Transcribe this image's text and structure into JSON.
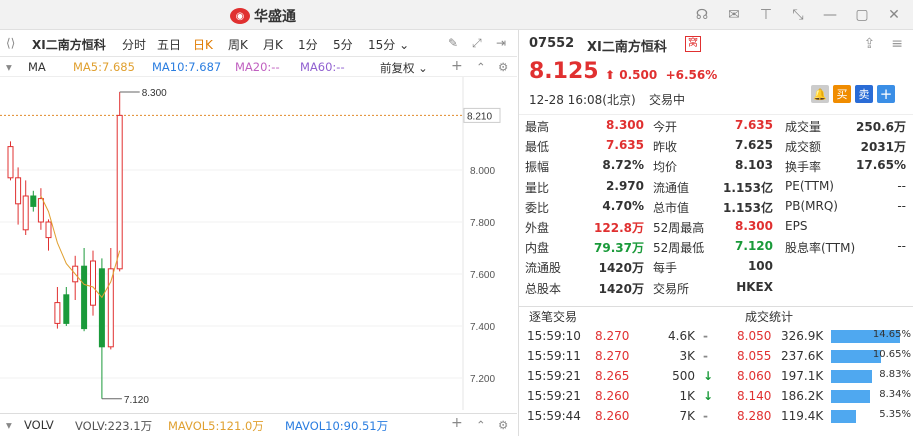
{
  "brand": {
    "name": "华盛通"
  },
  "toolbar": {
    "title": "XI二南方恒科",
    "periods": [
      "分时",
      "五日",
      "日K",
      "周K",
      "月K",
      "1分",
      "5分",
      "15分 ⌄"
    ],
    "active": "日K"
  },
  "indicators": {
    "ma": "MA",
    "ma5": "MA5:7.685",
    "ma10": "MA10:7.687",
    "ma20": "MA20:--",
    "ma60": "MA60:--",
    "adjust": "前复权 ⌄",
    "plus": "+",
    "gear": "⚙"
  },
  "chart_data": {
    "type": "candlestick",
    "y_ticks": [
      "8.000",
      "7.800",
      "7.600",
      "7.400",
      "7.200"
    ],
    "high_label": "8.300",
    "low_label": "7.120",
    "current_label": "8.210",
    "candles": [
      {
        "o": 7.97,
        "c": 8.09,
        "h": 8.11,
        "l": 7.96
      },
      {
        "o": 7.87,
        "c": 7.97,
        "h": 8.01,
        "l": 7.79
      },
      {
        "o": 7.77,
        "c": 7.9,
        "h": 7.96,
        "l": 7.75
      },
      {
        "o": 7.9,
        "c": 7.86,
        "h": 7.92,
        "l": 7.84
      },
      {
        "o": 7.8,
        "c": 7.89,
        "h": 7.93,
        "l": 7.77
      },
      {
        "o": 7.74,
        "c": 7.8,
        "h": 7.81,
        "l": 7.69
      },
      {
        "o": 7.41,
        "c": 7.49,
        "h": 7.55,
        "l": 7.39
      },
      {
        "o": 7.52,
        "c": 7.41,
        "h": 7.55,
        "l": 7.4
      },
      {
        "o": 7.57,
        "c": 7.63,
        "h": 7.67,
        "l": 7.5
      },
      {
        "o": 7.63,
        "c": 7.39,
        "h": 7.7,
        "l": 7.38
      },
      {
        "o": 7.48,
        "c": 7.65,
        "h": 7.69,
        "l": 7.44
      },
      {
        "o": 7.62,
        "c": 7.32,
        "h": 7.66,
        "l": 7.12
      },
      {
        "o": 7.32,
        "c": 7.62,
        "h": 7.7,
        "l": 7.31
      },
      {
        "o": 7.62,
        "c": 8.21,
        "h": 8.3,
        "l": 7.61
      }
    ],
    "ma_line": [
      null,
      null,
      null,
      null,
      7.9,
      7.84,
      7.72,
      7.64,
      7.6,
      7.56,
      7.55,
      7.51,
      7.57,
      7.69
    ]
  },
  "volume": {
    "volv": "VOLV",
    "volv_val": "VOLV:223.1万",
    "mavol5": "MAVOL5:121.0万",
    "mavol10": "MAVOL10:90.51万"
  },
  "stock": {
    "code": "07552",
    "name": "XI二南方恒科",
    "badge": "窝",
    "price": "8.125",
    "change": "0.500",
    "change_pct": "+6.56%",
    "time": "12-28  16:08(北京)",
    "status": "交易中",
    "buy": "买",
    "sell": "卖",
    "add": "+"
  },
  "stats": [
    [
      {
        "l": "最高",
        "v": "8.300",
        "c": "r"
      },
      {
        "l": "今开",
        "v": "7.635",
        "c": "r"
      },
      {
        "l": "成交量",
        "v": "250.6万",
        "c": "b"
      }
    ],
    [
      {
        "l": "最低",
        "v": "7.635",
        "c": "r"
      },
      {
        "l": "昨收",
        "v": "7.625",
        "c": "b"
      },
      {
        "l": "成交额",
        "v": "2031万",
        "c": "b"
      }
    ],
    [
      {
        "l": "振幅",
        "v": "8.72%",
        "c": "b"
      },
      {
        "l": "均价",
        "v": "8.103",
        "c": "b"
      },
      {
        "l": "换手率",
        "v": "17.65%",
        "c": "b"
      }
    ],
    [
      {
        "l": "量比",
        "v": "2.970",
        "c": "b"
      },
      {
        "l": "流通值",
        "v": "1.153亿",
        "c": "b"
      },
      {
        "l": "PE(TTM)",
        "v": "--",
        "c": "l"
      }
    ],
    [
      {
        "l": "委比",
        "v": "4.70%",
        "c": "b"
      },
      {
        "l": "总市值",
        "v": "1.153亿",
        "c": "b"
      },
      {
        "l": "PB(MRQ)",
        "v": "--",
        "c": "l"
      }
    ],
    [
      {
        "l": "外盘",
        "v": "122.8万",
        "c": "r"
      },
      {
        "l": "52周最高",
        "v": "8.300",
        "c": "r"
      },
      {
        "l": "EPS",
        "v": "",
        "c": "l"
      }
    ],
    [
      {
        "l": "内盘",
        "v": "79.37万",
        "c": "g"
      },
      {
        "l": "52周最低",
        "v": "7.120",
        "c": "g"
      },
      {
        "l": "股息率(TTM)",
        "v": "--",
        "c": "l"
      }
    ],
    [
      {
        "l": "流通股",
        "v": "1420万",
        "c": "b"
      },
      {
        "l": "每手",
        "v": "100",
        "c": "b"
      },
      {
        "l": "",
        "v": "",
        "c": "l"
      }
    ],
    [
      {
        "l": "总股本",
        "v": "1420万",
        "c": "b"
      },
      {
        "l": "交易所",
        "v": "HKEX",
        "c": "b"
      },
      {
        "l": "",
        "v": "",
        "c": "l"
      }
    ]
  ],
  "trades_title": "逐笔交易",
  "stats_title": "成交统计",
  "trades": [
    {
      "t": "15:59:10",
      "p": "8.270",
      "q": "4.6K",
      "d": "-",
      "sp": "8.050",
      "sv": "326.9K",
      "pct": "14.65%",
      "f": 0.98
    },
    {
      "t": "15:59:11",
      "p": "8.270",
      "q": "3K",
      "d": "-",
      "sp": "8.055",
      "sv": "237.6K",
      "pct": "10.65%",
      "f": 0.71
    },
    {
      "t": "15:59:21",
      "p": "8.265",
      "q": "500",
      "d": "↓",
      "sp": "8.060",
      "sv": "197.1K",
      "pct": "8.83%",
      "f": 0.59
    },
    {
      "t": "15:59:21",
      "p": "8.260",
      "q": "1K",
      "d": "↓",
      "sp": "8.140",
      "sv": "186.2K",
      "pct": "8.34%",
      "f": 0.56
    },
    {
      "t": "15:59:44",
      "p": "8.260",
      "q": "7K",
      "d": "-",
      "sp": "8.280",
      "sv": "119.4K",
      "pct": "5.35%",
      "f": 0.36
    }
  ]
}
